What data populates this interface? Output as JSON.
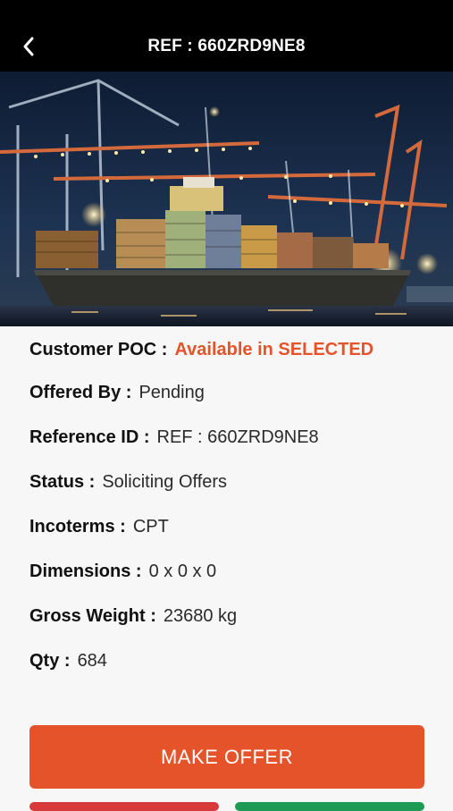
{
  "header": {
    "title": "REF : 660ZRD9NE8",
    "back_icon": "chevron-left-icon"
  },
  "hero": {
    "image": "cargo-ship-port-at-night"
  },
  "details": {
    "customer_poc": {
      "label": "Customer POC :",
      "value": "Available in SELECTED"
    },
    "offered_by": {
      "label": "Offered By :",
      "value": "Pending"
    },
    "reference_id": {
      "label": "Reference ID :",
      "value": "REF : 660ZRD9NE8"
    },
    "status": {
      "label": "Status :",
      "value": "Soliciting Offers"
    },
    "incoterms": {
      "label": "Incoterms :",
      "value": "CPT"
    },
    "dimensions": {
      "label": "Dimensions :",
      "value": "0 x 0 x 0"
    },
    "gross_weight": {
      "label": "Gross Weight :",
      "value": "23680 kg"
    },
    "qty": {
      "label": "Qty :",
      "value": "684"
    }
  },
  "actions": {
    "make_offer_label": "MAKE OFFER"
  },
  "colors": {
    "accent": "#e5532a",
    "header_bg": "#000000",
    "decline": "#d63a3a",
    "accept": "#1f9a55"
  }
}
